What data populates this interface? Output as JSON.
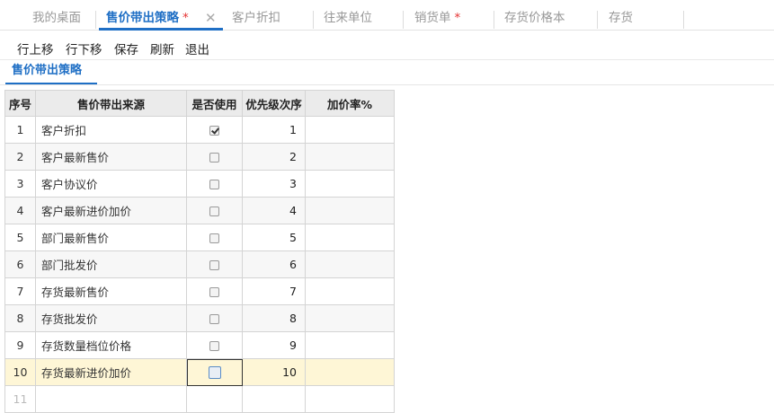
{
  "tabs": [
    {
      "label": "我的桌面",
      "active": false,
      "modified": false
    },
    {
      "label": "售价带出策略",
      "active": true,
      "modified": true
    },
    {
      "label": "客户折扣",
      "active": false,
      "modified": false
    },
    {
      "label": "往来单位",
      "active": false,
      "modified": false
    },
    {
      "label": "销货单",
      "active": false,
      "modified": true
    },
    {
      "label": "存货价格本",
      "active": false,
      "modified": false
    },
    {
      "label": "存货",
      "active": false,
      "modified": false
    }
  ],
  "modified_marker": "*",
  "close_glyph": "✕",
  "toolbar": {
    "move_up": "行上移",
    "move_down": "行下移",
    "save": "保存",
    "refresh": "刷新",
    "exit": "退出"
  },
  "subtab": "售价带出策略",
  "grid": {
    "columns": [
      "序号",
      "售价带出来源",
      "是否使用",
      "优先级次序",
      "加价率%"
    ],
    "rows": [
      {
        "no": "1",
        "source": "客户折扣",
        "used": true,
        "priority": "1",
        "markup": ""
      },
      {
        "no": "2",
        "source": "客户最新售价",
        "used": false,
        "priority": "2",
        "markup": ""
      },
      {
        "no": "3",
        "source": "客户协议价",
        "used": false,
        "priority": "3",
        "markup": ""
      },
      {
        "no": "4",
        "source": "客户最新进价加价",
        "used": false,
        "priority": "4",
        "markup": ""
      },
      {
        "no": "5",
        "source": "部门最新售价",
        "used": false,
        "priority": "5",
        "markup": ""
      },
      {
        "no": "6",
        "source": "部门批发价",
        "used": false,
        "priority": "6",
        "markup": ""
      },
      {
        "no": "7",
        "source": "存货最新售价",
        "used": false,
        "priority": "7",
        "markup": ""
      },
      {
        "no": "8",
        "source": "存货批发价",
        "used": false,
        "priority": "8",
        "markup": ""
      },
      {
        "no": "9",
        "source": "存货数量档位价格",
        "used": false,
        "priority": "9",
        "markup": ""
      },
      {
        "no": "10",
        "source": "存货最新进价加价",
        "used": false,
        "priority": "10",
        "markup": ""
      }
    ],
    "empty_row_no": "11",
    "selected_row": "10"
  },
  "colors": {
    "accent": "#1f6fc5",
    "modified_star": "#e53333",
    "selected_row": "#fef6d6",
    "header_bg": "#ebebeb"
  }
}
